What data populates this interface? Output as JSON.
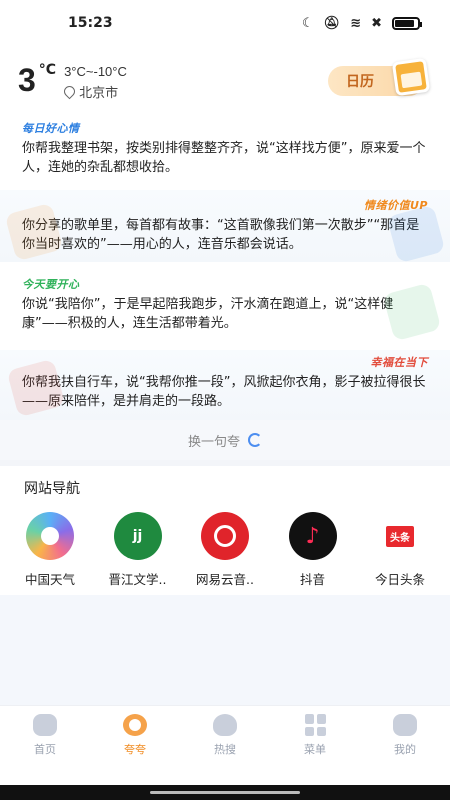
{
  "status_bar": {
    "time": "15:23",
    "icons": [
      "moon-icon",
      "mute-icon",
      "wifi-icon",
      "sim-off-icon",
      "battery-icon"
    ],
    "battery_level": 0.85
  },
  "weather": {
    "temp": "3",
    "unit": "°C",
    "range": "3°C~-10°C",
    "city": "北京市"
  },
  "calendar": {
    "label": "日历"
  },
  "quotes": [
    {
      "tag": "每日好心情",
      "text": "你帮我整理书架，按类别排得整整齐齐，说“这样找方便”，原来爱一个人，连她的杂乱都想收拾。"
    },
    {
      "tag": "情绪价值UP",
      "text": "你分享的歌单里，每首都有故事：“这首歌像我们第一次散步”“那首是你当时喜欢的”——用心的人，连音乐都会说话。"
    },
    {
      "tag": "今天要开心",
      "text": "你说“我陪你”，于是早起陪我跑步，汗水滴在跑道上，说“这样健康”——积极的人，连生活都带着光。"
    },
    {
      "tag": "幸福在当下",
      "text": "你帮我扶自行车，说“我帮你推一段”，风掀起你衣角，影子被拉得很长——原来陪伴，是并肩走的一段路。"
    }
  ],
  "refresh": {
    "label": "换一句夸"
  },
  "site_nav": {
    "title": "网站导航",
    "items": [
      {
        "label": "中国天气",
        "icon": "china-weather-icon"
      },
      {
        "label": "晋江文学..",
        "icon": "jjwxc-icon",
        "glyph": "jj"
      },
      {
        "label": "网易云音..",
        "icon": "netease-music-icon"
      },
      {
        "label": "抖音",
        "icon": "douyin-icon",
        "glyph": "♪"
      },
      {
        "label": "今日头条",
        "icon": "toutiao-icon",
        "glyph": "头条"
      }
    ]
  },
  "tabs": [
    {
      "label": "首页",
      "icon": "home-icon"
    },
    {
      "label": "夸夸",
      "icon": "medal-icon",
      "active": true
    },
    {
      "label": "热搜",
      "icon": "fire-icon"
    },
    {
      "label": "菜单",
      "icon": "menu-grid-icon"
    },
    {
      "label": "我的",
      "icon": "profile-icon"
    }
  ],
  "colors": {
    "accent": "#f08a1f",
    "blue_tag": "#2d7fe0",
    "green_tag": "#2fb25a",
    "red_tag": "#e24b3b"
  }
}
